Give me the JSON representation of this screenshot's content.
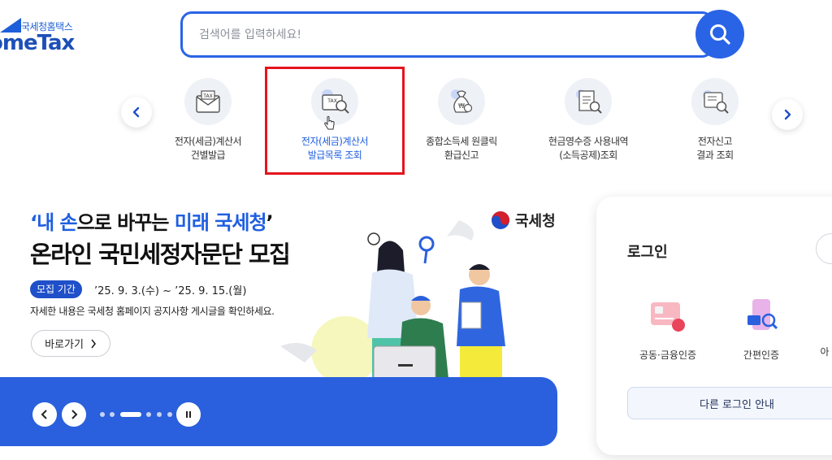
{
  "logo": {
    "subtitle": "국세청홈택스",
    "title": "omeTax"
  },
  "search": {
    "placeholder": "검색어를 입력하세요!"
  },
  "quick_menu": {
    "items": [
      {
        "label": "전자(세금)계산서\n건별발급",
        "icon": "tax-envelope-icon"
      },
      {
        "label": "전자(세금)계산서\n발급목록 조회",
        "icon": "tax-search-icon",
        "active": true
      },
      {
        "label": "종합소득세 원클릭\n환급신고",
        "icon": "money-bag-icon"
      },
      {
        "label": "현금영수증 사용내역\n(소득공제)조회",
        "icon": "receipt-search-icon"
      },
      {
        "label": "전자신고\n결과 조회",
        "icon": "document-search-icon"
      }
    ]
  },
  "banner": {
    "heading_line1_part1": "‘내 손",
    "heading_line1_part2": "으로 바꾸는 ",
    "heading_line1_part3": "미래 국세청",
    "heading_line1_part4": "’",
    "heading_line2": "온라인 국민세정자문단 모집",
    "period_label": "모집 기간",
    "period": "’25. 9. 3.(수) ~ ’25. 9. 15.(월)",
    "description": "자세한 내용은 국세청 홈페이지 공지사항 게시글을 확인하세요.",
    "go_button": "바로가기",
    "org_name": "국세청"
  },
  "login": {
    "title": "로그인",
    "methods": [
      {
        "label": "공동·금융인증",
        "icon": "certificate-card-icon"
      },
      {
        "label": "간편인증",
        "icon": "phone-auth-icon"
      },
      {
        "label": "아",
        "icon": "id-icon"
      }
    ],
    "other_button": "다른 로그인 안내"
  },
  "colors": {
    "primary": "#2a64e6",
    "highlight": "#e5141c",
    "banner_bar": "#2a60dd"
  }
}
